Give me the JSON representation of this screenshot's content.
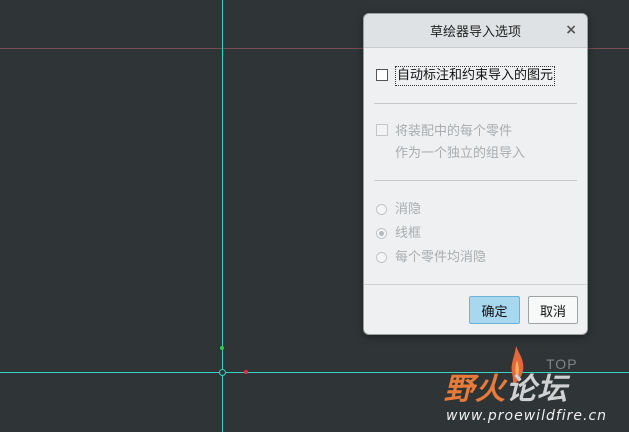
{
  "canvas": {
    "view_label": "TOP",
    "colors": {
      "background": "#2f3536",
      "axis": "#36d3c3",
      "reference": "#7a4a55"
    }
  },
  "dialog": {
    "title": "草绘器导入选项",
    "close_symbol": "×",
    "auto_dim_checkbox": {
      "label": "自动标注和约束导入的图元",
      "checked": false
    },
    "part_group_checkbox": {
      "label_line1": "将装配中的每个零件",
      "label_line2": "作为一个独立的组导入",
      "checked": false,
      "enabled": false
    },
    "radio_options": [
      {
        "label": "消隐",
        "checked": false
      },
      {
        "label": "线框",
        "checked": true
      },
      {
        "label": "每个零件均消隐",
        "checked": false
      }
    ],
    "ok_label": "确定",
    "cancel_label": "取消"
  },
  "watermark": {
    "logo_part1": "野火",
    "logo_part2": "论坛",
    "url": "www.proewildfire.cn"
  }
}
